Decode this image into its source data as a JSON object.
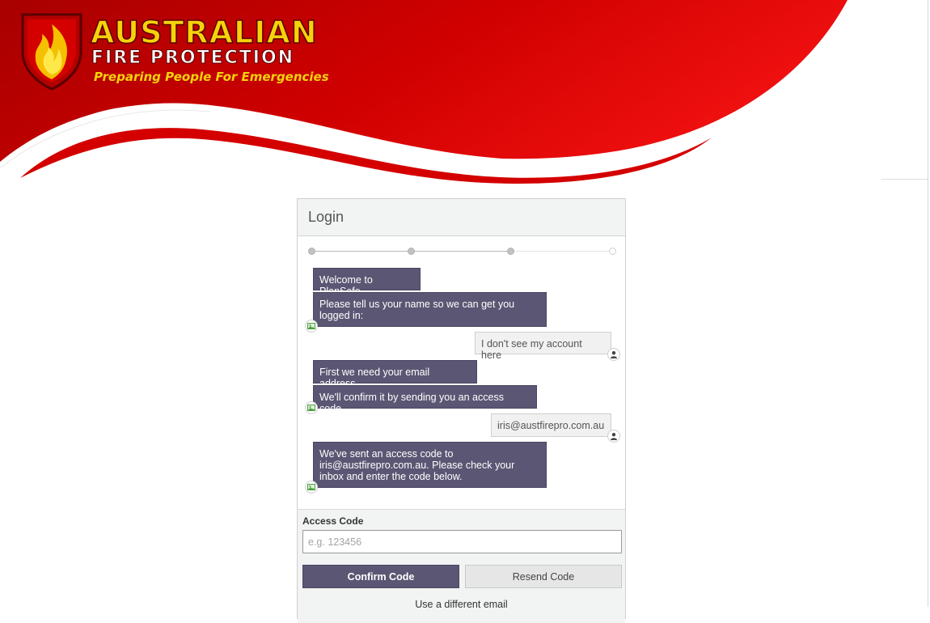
{
  "brand": {
    "line1": "AUSTRALIAN",
    "line2": "FIRE PROTECTION",
    "tagline": "Preparing People For Emergencies",
    "primary_color": "#cc0000",
    "accent_color": "#f5d20a"
  },
  "login": {
    "title": "Login",
    "steps_total": 4,
    "steps_completed": 3,
    "messages": [
      {
        "from": "bot",
        "text": "Welcome to PlanSafe"
      },
      {
        "from": "bot",
        "text": "Please tell us your name so we can get you logged in:"
      },
      {
        "from": "user",
        "text": "I don't see my account here"
      },
      {
        "from": "bot",
        "text": "First we need your email address."
      },
      {
        "from": "bot",
        "text": "We'll confirm it by sending you an access code."
      },
      {
        "from": "user",
        "text": "iris@austfirepro.com.au"
      },
      {
        "from": "bot",
        "text": "We've sent an access code to iris@austfirepro.com.au. Please check your inbox and enter the code below."
      }
    ],
    "access_code_label": "Access Code",
    "access_code_placeholder": "e.g. 123456",
    "access_code_value": "",
    "confirm_label": "Confirm Code",
    "resend_label": "Resend Code",
    "different_email_label": "Use a different email"
  },
  "icons": {
    "bot_avatar": "chat-bot-icon",
    "user_avatar": "user-icon",
    "logo": "flame-shield-icon"
  },
  "colors": {
    "bot_bubble": "#5b5673",
    "user_bubble": "#f1f1f1"
  }
}
